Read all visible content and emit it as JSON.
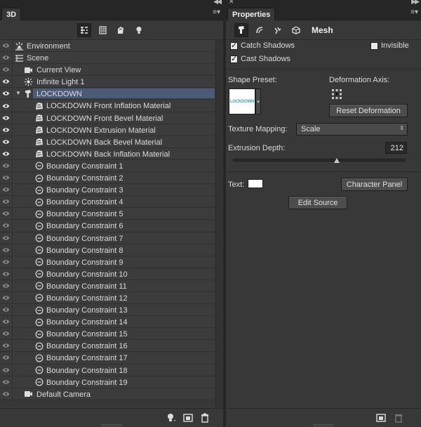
{
  "panel3d": {
    "tab": "3D",
    "toolbar": [
      {
        "icon": "whole-scene-filter-icon",
        "active": true
      },
      {
        "icon": "mesh-filter-icon",
        "active": false
      },
      {
        "icon": "material-filter-icon",
        "active": false
      },
      {
        "icon": "light-filter-icon",
        "active": false
      }
    ],
    "items": [
      {
        "label": "Environment",
        "icon": "environment-icon",
        "indent": 0,
        "eye": "dim",
        "twisty": ""
      },
      {
        "label": "Scene",
        "icon": "scene-icon",
        "indent": 0,
        "eye": "dim",
        "twisty": ""
      },
      {
        "label": "Current View",
        "icon": "camera-icon",
        "indent": 1,
        "eye": "dim",
        "twisty": ""
      },
      {
        "label": "Infinite Light 1",
        "icon": "light-icon",
        "indent": 1,
        "eye": "on",
        "twisty": ""
      },
      {
        "label": "LOCKDOWN",
        "icon": "mesh-icon",
        "indent": 1,
        "eye": "on",
        "twisty": "▼",
        "selected": true
      },
      {
        "label": "LOCKDOWN Front Inflation Material",
        "icon": "material-icon",
        "indent": 2,
        "eye": "on",
        "twisty": ""
      },
      {
        "label": "LOCKDOWN Front Bevel Material",
        "icon": "material-icon",
        "indent": 2,
        "eye": "on",
        "twisty": ""
      },
      {
        "label": "LOCKDOWN Extrusion Material",
        "icon": "material-icon",
        "indent": 2,
        "eye": "on",
        "twisty": ""
      },
      {
        "label": "LOCKDOWN Back Bevel Material",
        "icon": "material-icon",
        "indent": 2,
        "eye": "on",
        "twisty": ""
      },
      {
        "label": "LOCKDOWN Back Inflation Material",
        "icon": "material-icon",
        "indent": 2,
        "eye": "on",
        "twisty": ""
      },
      {
        "label": "Boundary Constraint 1",
        "icon": "constraint-icon",
        "indent": 2,
        "eye": "dim",
        "twisty": ""
      },
      {
        "label": "Boundary Constraint 2",
        "icon": "constraint-icon",
        "indent": 2,
        "eye": "dim",
        "twisty": ""
      },
      {
        "label": "Boundary Constraint 3",
        "icon": "constraint-icon",
        "indent": 2,
        "eye": "dim",
        "twisty": ""
      },
      {
        "label": "Boundary Constraint 4",
        "icon": "constraint-icon",
        "indent": 2,
        "eye": "dim",
        "twisty": ""
      },
      {
        "label": "Boundary Constraint 5",
        "icon": "constraint-icon",
        "indent": 2,
        "eye": "dim",
        "twisty": ""
      },
      {
        "label": "Boundary Constraint 6",
        "icon": "constraint-icon",
        "indent": 2,
        "eye": "dim",
        "twisty": ""
      },
      {
        "label": "Boundary Constraint 7",
        "icon": "constraint-icon",
        "indent": 2,
        "eye": "dim",
        "twisty": ""
      },
      {
        "label": "Boundary Constraint 8",
        "icon": "constraint-icon",
        "indent": 2,
        "eye": "dim",
        "twisty": ""
      },
      {
        "label": "Boundary Constraint 9",
        "icon": "constraint-icon",
        "indent": 2,
        "eye": "dim",
        "twisty": ""
      },
      {
        "label": "Boundary Constraint 10",
        "icon": "constraint-icon",
        "indent": 2,
        "eye": "dim",
        "twisty": ""
      },
      {
        "label": "Boundary Constraint 11",
        "icon": "constraint-icon",
        "indent": 2,
        "eye": "dim",
        "twisty": ""
      },
      {
        "label": "Boundary Constraint 12",
        "icon": "constraint-icon",
        "indent": 2,
        "eye": "dim",
        "twisty": ""
      },
      {
        "label": "Boundary Constraint 13",
        "icon": "constraint-icon",
        "indent": 2,
        "eye": "dim",
        "twisty": ""
      },
      {
        "label": "Boundary Constraint 14",
        "icon": "constraint-icon",
        "indent": 2,
        "eye": "dim",
        "twisty": ""
      },
      {
        "label": "Boundary Constraint 15",
        "icon": "constraint-icon",
        "indent": 2,
        "eye": "dim",
        "twisty": ""
      },
      {
        "label": "Boundary Constraint 16",
        "icon": "constraint-icon",
        "indent": 2,
        "eye": "dim",
        "twisty": ""
      },
      {
        "label": "Boundary Constraint 17",
        "icon": "constraint-icon",
        "indent": 2,
        "eye": "dim",
        "twisty": ""
      },
      {
        "label": "Boundary Constraint 18",
        "icon": "constraint-icon",
        "indent": 2,
        "eye": "dim",
        "twisty": ""
      },
      {
        "label": "Boundary Constraint 19",
        "icon": "constraint-icon",
        "indent": 2,
        "eye": "dim",
        "twisty": ""
      },
      {
        "label": "Default Camera",
        "icon": "camera-icon",
        "indent": 1,
        "eye": "dim",
        "twisty": ""
      }
    ],
    "bottom_icons": [
      "add-light-icon",
      "render-icon",
      "trash-icon"
    ]
  },
  "properties": {
    "tab": "Properties",
    "header_title": "Mesh",
    "catch_shadows": {
      "label": "Catch Shadows",
      "checked": true
    },
    "cast_shadows": {
      "label": "Cast Shadows",
      "checked": true
    },
    "invisible": {
      "label": "Invisible",
      "checked": false
    },
    "shape_preset_label": "Shape Preset:",
    "shape_preset_thumb_text": "LOCKDOWN",
    "deformation_axis_label": "Deformation Axis:",
    "reset_deformation": "Reset Deformation",
    "texture_mapping_label": "Texture Mapping:",
    "texture_mapping_value": "Scale",
    "extrusion_depth_label": "Extrusion Depth:",
    "extrusion_depth_value": "212",
    "extrusion_slider_fraction": 0.6,
    "text_label": "Text:",
    "character_panel": "Character Panel",
    "edit_source": "Edit Source"
  },
  "colors": {
    "selection": "#4a5b78",
    "panel": "#383838",
    "accent_thumb": "#3aa6b9"
  }
}
